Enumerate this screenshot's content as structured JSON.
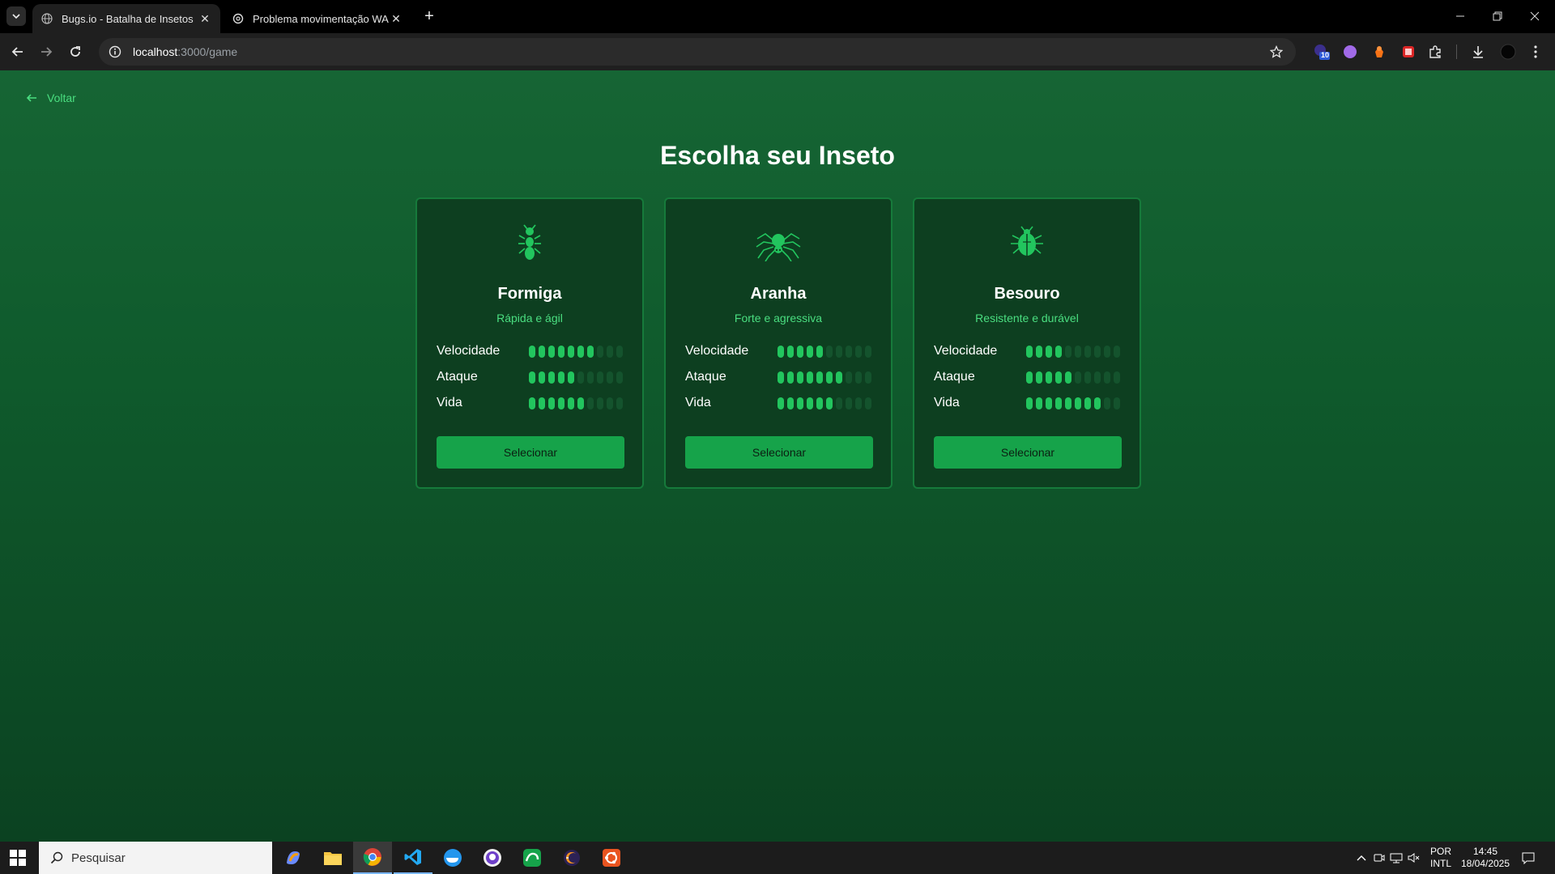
{
  "browser": {
    "tabs": [
      {
        "title": "Bugs.io - Batalha de Insetos",
        "active": true
      },
      {
        "title": "Problema movimentação WASD",
        "active": false
      }
    ],
    "url_host": "localhost",
    "url_path": ":3000/game"
  },
  "page": {
    "back_label": "Voltar",
    "title": "Escolha seu Inseto",
    "select_label": "Selecionar",
    "stat_labels": {
      "speed": "Velocidade",
      "attack": "Ataque",
      "life": "Vida"
    },
    "max_pips": 10,
    "colors": {
      "accent": "#4ade80",
      "pip_on": "#22c55e",
      "pip_off": "#14532d",
      "button": "#16a34a",
      "card_bg": "#0d3f20",
      "card_border": "#167a3b"
    },
    "insects": [
      {
        "name": "Formiga",
        "tagline": "Rápida e ágil",
        "icon": "ant-icon",
        "speed": 7,
        "attack": 5,
        "life": 6
      },
      {
        "name": "Aranha",
        "tagline": "Forte e agressiva",
        "icon": "spider-icon",
        "speed": 5,
        "attack": 7,
        "life": 6
      },
      {
        "name": "Besouro",
        "tagline": "Resistente e durável",
        "icon": "beetle-icon",
        "speed": 4,
        "attack": 5,
        "life": 8
      }
    ]
  },
  "taskbar": {
    "search_placeholder": "Pesquisar",
    "lang_top": "POR",
    "lang_bottom": "INTL",
    "time": "14:45",
    "date": "18/04/2025",
    "extension_badge": "10"
  }
}
